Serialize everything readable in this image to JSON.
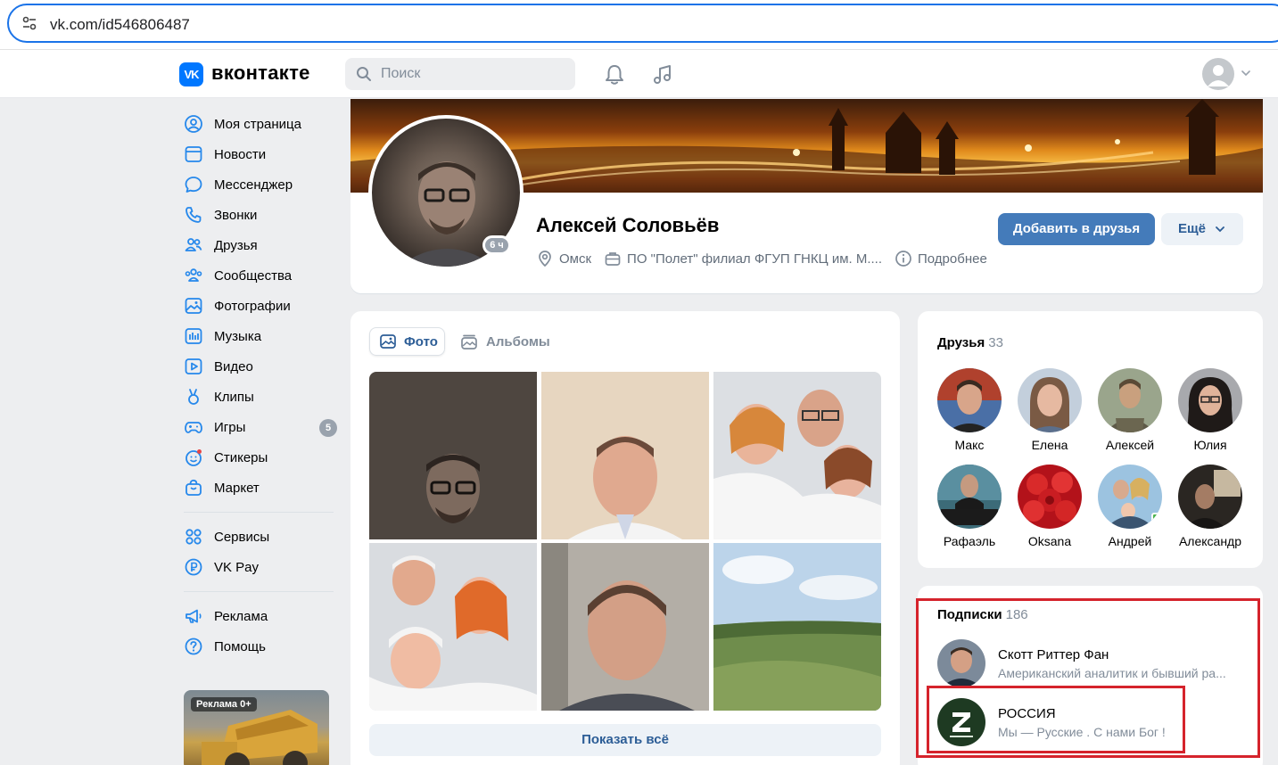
{
  "browser": {
    "url": "vk.com/id546806487"
  },
  "header": {
    "logo_mark": "VK",
    "logo_text": "вконтакте",
    "search_placeholder": "Поиск"
  },
  "sidebar": {
    "items": [
      {
        "label": "Моя страница",
        "icon": "user-circle-icon"
      },
      {
        "label": "Новости",
        "icon": "news-icon"
      },
      {
        "label": "Мессенджер",
        "icon": "chat-bubble-icon"
      },
      {
        "label": "Звонки",
        "icon": "phone-icon"
      },
      {
        "label": "Друзья",
        "icon": "friends-icon"
      },
      {
        "label": "Сообщества",
        "icon": "communities-icon"
      },
      {
        "label": "Фотографии",
        "icon": "photo-icon"
      },
      {
        "label": "Музыка",
        "icon": "music-icon"
      },
      {
        "label": "Видео",
        "icon": "video-icon"
      },
      {
        "label": "Клипы",
        "icon": "clips-icon"
      },
      {
        "label": "Игры",
        "icon": "gamepad-icon",
        "badge": "5"
      },
      {
        "label": "Стикеры",
        "icon": "sticker-icon"
      },
      {
        "label": "Маркет",
        "icon": "market-bag-icon"
      }
    ],
    "services": [
      {
        "label": "Сервисы",
        "icon": "grid-icon"
      },
      {
        "label": "VK Pay",
        "icon": "ruble-icon"
      }
    ],
    "extra": [
      {
        "label": "Реклама",
        "icon": "megaphone-icon"
      },
      {
        "label": "Помощь",
        "icon": "help-icon"
      }
    ],
    "ad_label": "Реклама 0+"
  },
  "profile": {
    "name": "Алексей Соловьёв",
    "online": "6 ч",
    "city": "Омск",
    "work": "ПО \"Полет\" филиал ФГУП ГНКЦ им. М....",
    "details": "Подробнее",
    "add_friend": "Добавить в друзья",
    "more": "Ещё"
  },
  "photos": {
    "tab_photos": "Фото",
    "tab_albums": "Альбомы",
    "show_all": "Показать всё"
  },
  "friends": {
    "title": "Друзья",
    "count": "33",
    "list": [
      {
        "name": "Макс"
      },
      {
        "name": "Елена"
      },
      {
        "name": "Алексей"
      },
      {
        "name": "Юлия"
      },
      {
        "name": "Рафаэль"
      },
      {
        "name": "Oksana"
      },
      {
        "name": "Андрей"
      },
      {
        "name": "Александр"
      }
    ]
  },
  "subscriptions": {
    "title": "Подписки",
    "count": "186",
    "list": [
      {
        "title": "Скотт Риттер Фан",
        "desc": "Американский аналитик и бывший ра..."
      },
      {
        "title": "РОССИЯ",
        "desc": "Мы — Русские . С нами Бог !"
      }
    ]
  },
  "colors": {
    "accent": "#0077ff",
    "button_primary": "#447bba",
    "link": "#2c5d96",
    "annotation_red": "#d5232c"
  }
}
